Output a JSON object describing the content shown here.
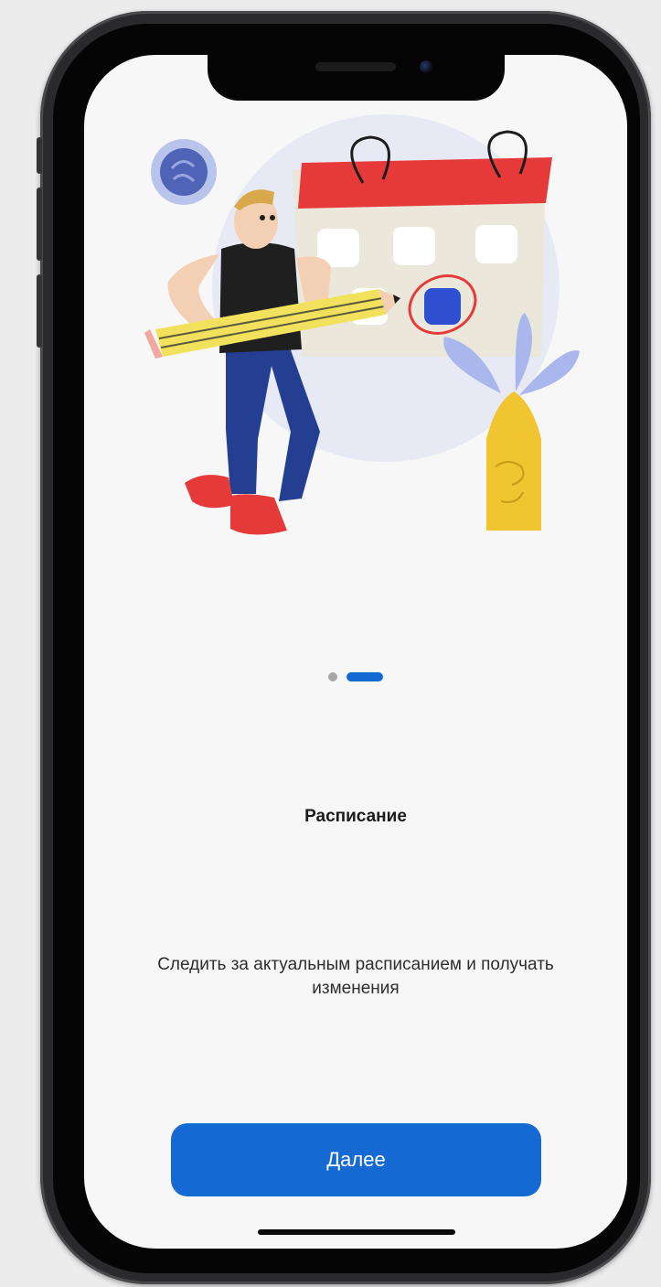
{
  "onboarding": {
    "title": "Расписание",
    "description": "Следить за актуальным расписанием и получать изменения",
    "next_label": "Далее",
    "pager": {
      "total": 2,
      "active_index": 1
    }
  },
  "colors": {
    "accent": "#1469d2",
    "screen_background": "#f7f7f7",
    "calendar_header": "#e63a3a",
    "pager_inactive": "#a7a7a7"
  },
  "illustration": {
    "icons": [
      "calendar-icon",
      "pencil-icon",
      "person-figure",
      "plant-icon",
      "badge-icon"
    ]
  }
}
